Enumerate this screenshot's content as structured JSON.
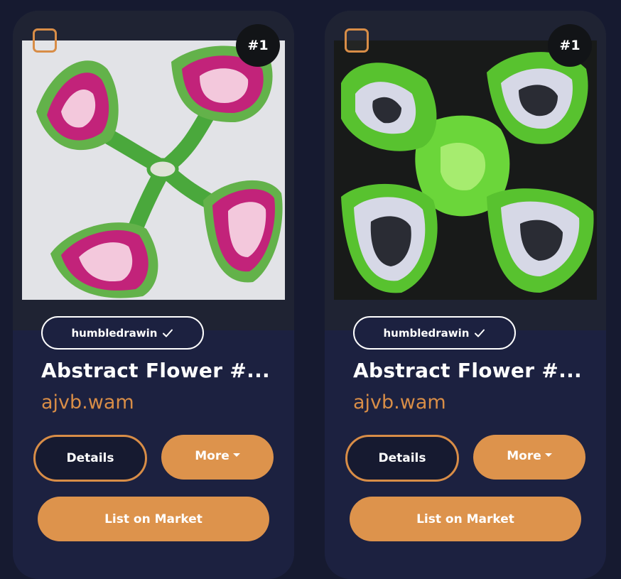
{
  "cards": [
    {
      "rank": "#1",
      "creator": "humbledrawin",
      "title": "Abstract Flower #...",
      "collection": "ajvb.wam",
      "details_label": "Details",
      "more_label": "More",
      "list_label": "List on Market",
      "art": {
        "background": "#e2e3e7",
        "petal_color": "#c2237a",
        "stem_color": "#4aa83c"
      }
    },
    {
      "rank": "#1",
      "creator": "humbledrawin",
      "title": "Abstract Flower #...",
      "collection": "ajvb.wam",
      "details_label": "Details",
      "more_label": "More",
      "list_label": "List on Market",
      "art": {
        "background": "#181a19",
        "petal_color": "#7ed43a",
        "stem_color": "#6bd63a"
      }
    }
  ],
  "colors": {
    "accent": "#dd934c",
    "card": "#1c2140",
    "page": "#161a30"
  }
}
